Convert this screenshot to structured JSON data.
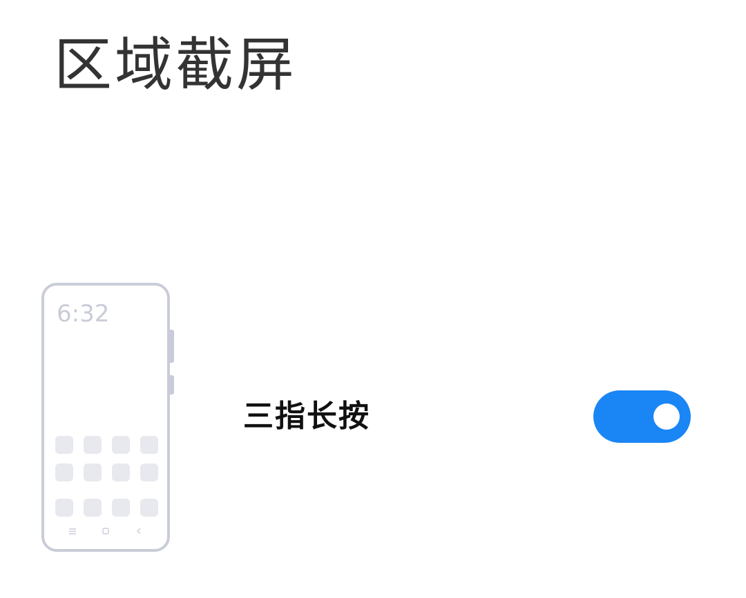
{
  "page": {
    "title": "区域截屏"
  },
  "illustration": {
    "phone_time": "6:32",
    "app_icon_count": 12,
    "nav_icons": [
      "menu-icon",
      "home-icon",
      "back-icon"
    ]
  },
  "setting": {
    "label": "三指长按",
    "toggle_on": true,
    "toggle_color": "#1a85f5"
  }
}
